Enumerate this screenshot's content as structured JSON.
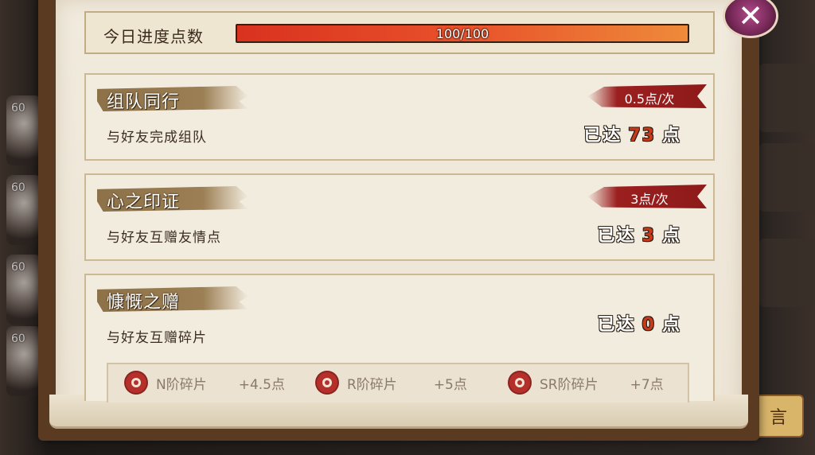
{
  "progress": {
    "label": "今日进度点数",
    "text": "100/100",
    "value": 1.0
  },
  "cards": [
    {
      "title": "组队同行",
      "desc": "与好友完成组队",
      "rate": "0.5点/次",
      "achieved_prefix": "已达",
      "achieved_value": "73",
      "achieved_suffix": "点"
    },
    {
      "title": "心之印证",
      "desc": "与好友互赠友情点",
      "rate": "3点/次",
      "achieved_prefix": "已达",
      "achieved_value": "3",
      "achieved_suffix": "点"
    },
    {
      "title": "慷慨之赠",
      "desc": "与好友互赠碎片",
      "achieved_prefix": "已达",
      "achieved_value": "0",
      "achieved_suffix": "点",
      "shards": [
        {
          "label": "N阶碎片",
          "bonus": "+4.5点"
        },
        {
          "label": "R阶碎片",
          "bonus": "+5点"
        },
        {
          "label": "SR阶碎片",
          "bonus": "+7点"
        }
      ]
    }
  ],
  "background": {
    "avatar_level": "60",
    "message_button": "言"
  },
  "close_icon": "close-icon",
  "colors": {
    "progress_fill": "#e8512a",
    "achieved_number": "#c83a18",
    "rate_badge": "#9b1f1f"
  }
}
